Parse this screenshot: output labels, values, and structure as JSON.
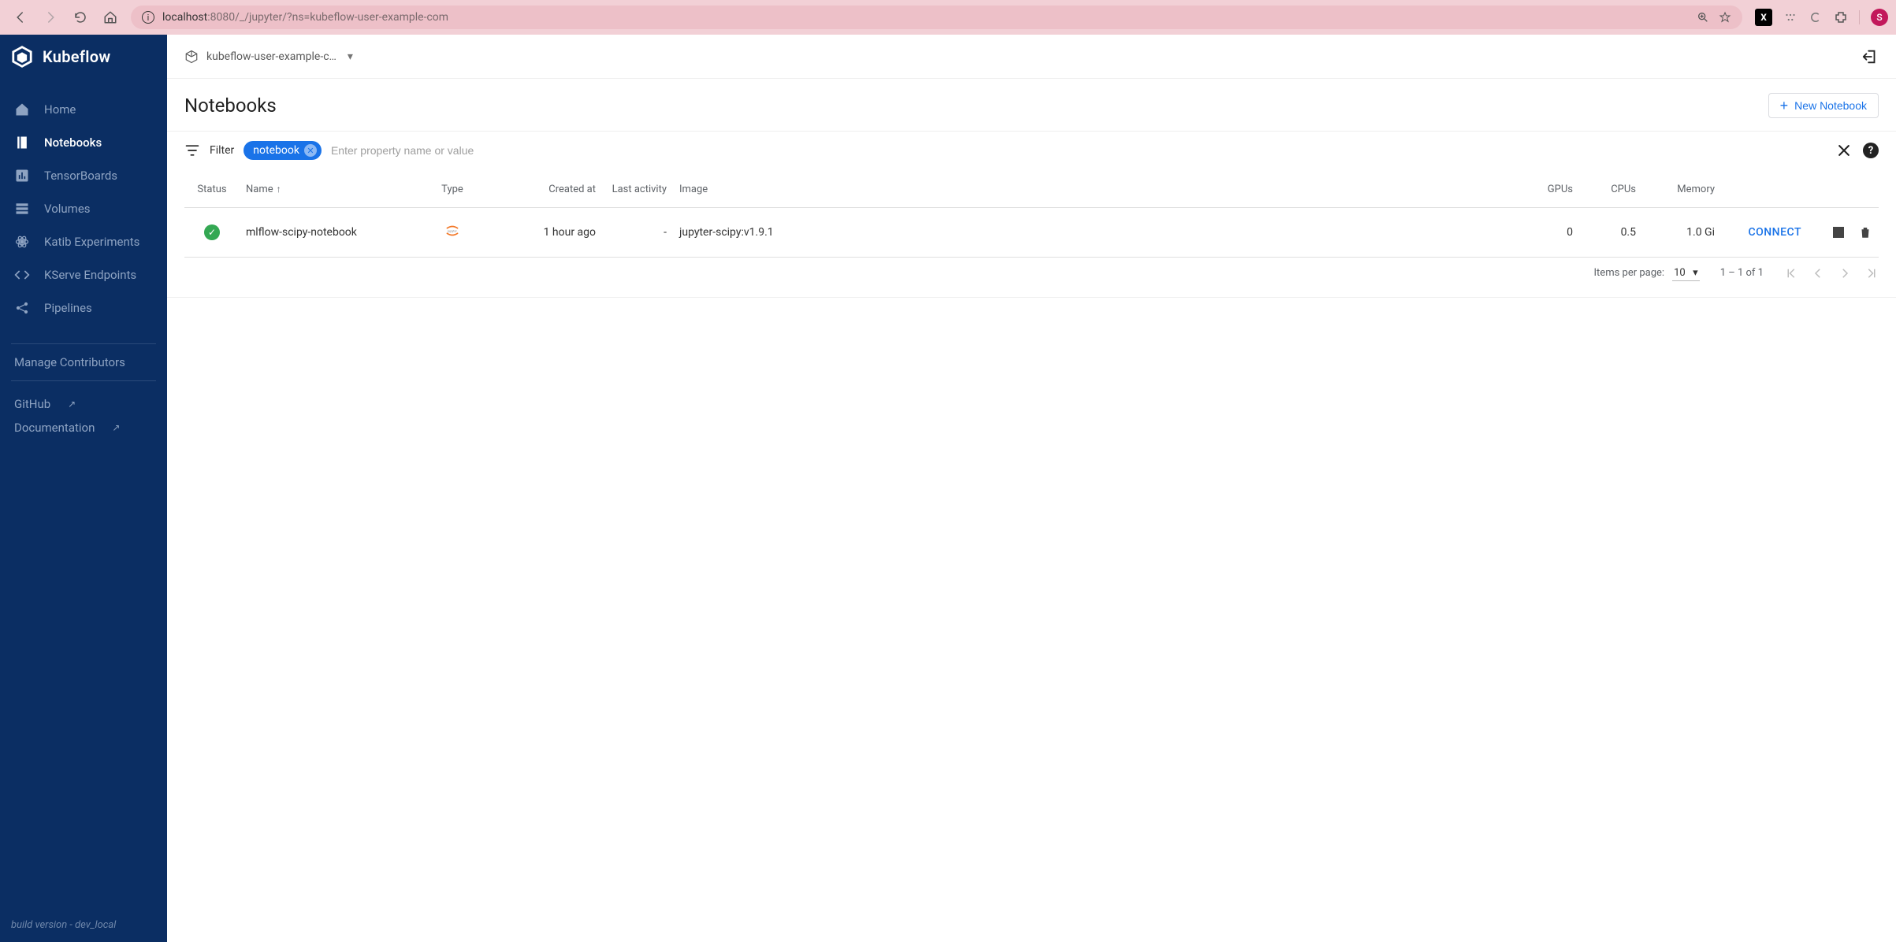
{
  "browser": {
    "url_host": "localhost",
    "url_rest": ":8080/_/jupyter/?ns=kubeflow-user-example-com",
    "avatar_letter": "S"
  },
  "sidebar": {
    "brand": "Kubeflow",
    "items": [
      {
        "label": "Home"
      },
      {
        "label": "Notebooks"
      },
      {
        "label": "TensorBoards"
      },
      {
        "label": "Volumes"
      },
      {
        "label": "Katib Experiments"
      },
      {
        "label": "KServe Endpoints"
      },
      {
        "label": "Pipelines"
      }
    ],
    "manage_label": "Manage Contributors",
    "external": [
      {
        "label": "GitHub"
      },
      {
        "label": "Documentation"
      }
    ],
    "footer": "build version - dev_local"
  },
  "header": {
    "namespace": "kubeflow-user-example-c…"
  },
  "page": {
    "title": "Notebooks",
    "new_label": "New Notebook"
  },
  "filter": {
    "label": "Filter",
    "chip": "notebook",
    "placeholder": "Enter property name or value"
  },
  "table": {
    "columns": {
      "status": "Status",
      "name": "Name",
      "type": "Type",
      "created": "Created at",
      "last_activity": "Last activity",
      "image": "Image",
      "gpus": "GPUs",
      "cpus": "CPUs",
      "memory": "Memory"
    },
    "rows": [
      {
        "name": "mlflow-scipy-notebook",
        "created": "1 hour ago",
        "last_activity": "-",
        "image": "jupyter-scipy:v1.9.1",
        "gpus": "0",
        "cpus": "0.5",
        "memory": "1.0 Gi",
        "action": "CONNECT"
      }
    ]
  },
  "paginator": {
    "items_per_page_label": "Items per page:",
    "items_per_page_value": "10",
    "range": "1 – 1 of 1"
  }
}
